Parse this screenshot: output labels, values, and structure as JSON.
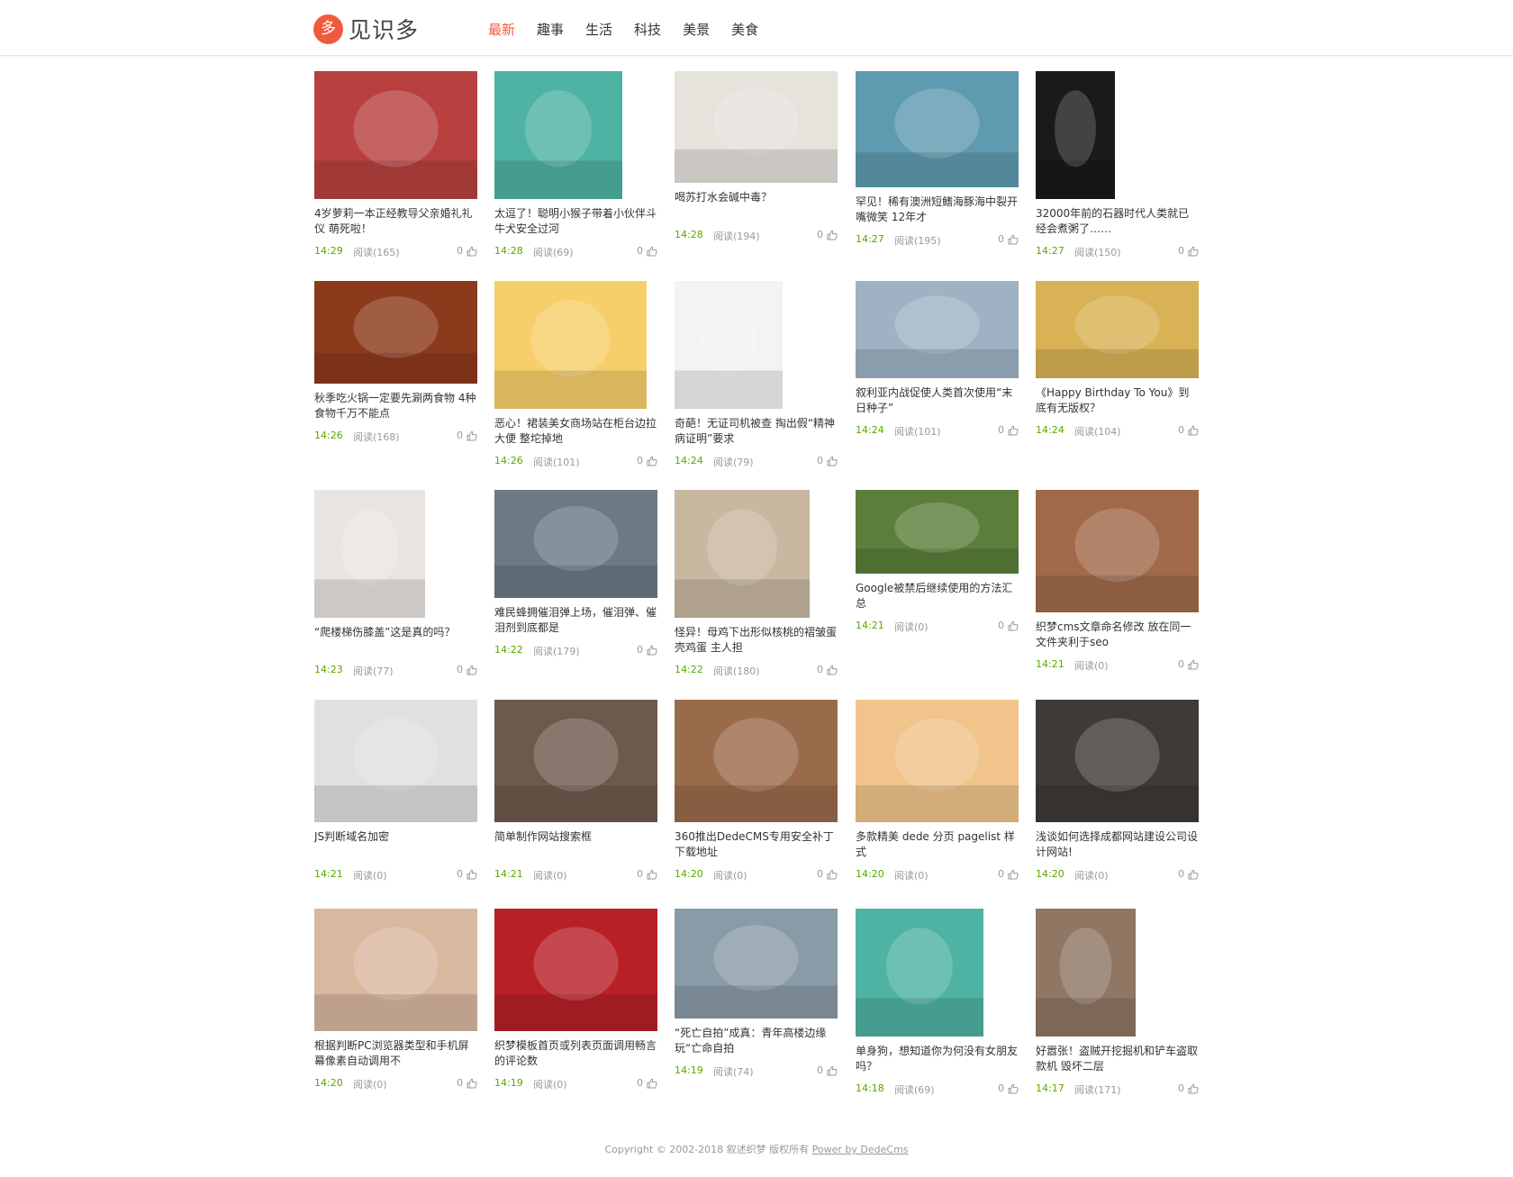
{
  "header": {
    "logo_mark": "多",
    "logo_text": "见识多",
    "nav": [
      {
        "label": "最新",
        "active": true
      },
      {
        "label": "趣事",
        "active": false
      },
      {
        "label": "生活",
        "active": false
      },
      {
        "label": "科技",
        "active": false
      },
      {
        "label": "美景",
        "active": false
      },
      {
        "label": "美食",
        "active": false
      }
    ]
  },
  "articles": [
    {
      "title": "4岁萝莉一本正经教导父亲婚礼礼仪 萌死啦！",
      "time": "14:29",
      "reads": "阅读(165)",
      "likes": "0",
      "image": "girl-red-dress-photo",
      "bg": "#b8413f"
    },
    {
      "title": "太逗了！聪明小猴子带着小伙伴斗牛犬安全过河",
      "time": "14:28",
      "reads": "阅读(69)",
      "likes": "0",
      "image": "face-mask-dog-photo",
      "bg": "#4fb3a4"
    },
    {
      "title": "喝苏打水会碱中毒？",
      "time": "14:28",
      "reads": "阅读(194)",
      "likes": "0",
      "image": "woman-drinking-water-photo",
      "bg": "#e6e2dc"
    },
    {
      "title": "罕见！稀有澳洲短鳍海豚海中裂开嘴微笑 12年才",
      "time": "14:27",
      "reads": "阅读(195)",
      "likes": "0",
      "image": "dolphin-photo",
      "bg": "#5f9bb0"
    },
    {
      "title": "32000年前的石器时代人类就已经会煮粥了……",
      "time": "14:27",
      "reads": "阅读(150)",
      "likes": "0",
      "image": "stone-tool-photo",
      "bg": "#1a1a1a"
    },
    {
      "title": "秋季吃火锅一定要先涮两食物 4种食物千万不能点",
      "time": "14:26",
      "reads": "阅读(168)",
      "likes": "0",
      "image": "hotpot-photo",
      "bg": "#8c3a1c"
    },
    {
      "title": "恶心！裙装美女商场站在柜台边拉大便 整坨掉地",
      "time": "14:26",
      "reads": "阅读(101)",
      "likes": "0",
      "image": "poop-emoji-illustration",
      "bg": "#f7cf6a"
    },
    {
      "title": "奇葩！无证司机被查 掏出假“精神病证明”要求",
      "time": "14:24",
      "reads": "阅读(79)",
      "likes": "0",
      "image": "cartoon-crazy-man-illustration",
      "bg": "#f3f3f3"
    },
    {
      "title": "叙利亚内战促使人类首次使用“末日种子”",
      "time": "14:24",
      "reads": "阅读(101)",
      "likes": "0",
      "image": "seed-vault-photo",
      "bg": "#9fb2c4"
    },
    {
      "title": "《Happy Birthday To You》到底有无版权？",
      "time": "14:24",
      "reads": "阅读(104)",
      "likes": "0",
      "image": "kids-singing-photo",
      "bg": "#d8b255"
    },
    {
      "title": "“爬楼梯伤膝盖”这是真的吗？",
      "time": "14:23",
      "reads": "阅读(77)",
      "likes": "0",
      "image": "woman-on-stairs-photo",
      "bg": "#e9e4e0"
    },
    {
      "title": "难民蜂拥催泪弹上场，催泪弹、催泪剂到底都是",
      "time": "14:22",
      "reads": "阅读(179)",
      "likes": "0",
      "image": "tear-gas-crowd-photo",
      "bg": "#6c7a86"
    },
    {
      "title": "怪异！母鸡下出形似核桃的褶皱蛋壳鸡蛋 主人担",
      "time": "14:22",
      "reads": "阅读(180)",
      "likes": "0",
      "image": "walnut-eggs-plate-photo",
      "bg": "#c8b8a0"
    },
    {
      "title": "Google被禁后继续使用的方法汇总",
      "time": "14:21",
      "reads": "阅读(0)",
      "likes": "0",
      "image": "google-sign-photo",
      "bg": "#5b7f3a"
    },
    {
      "title": "织梦cms文章命名修改 放在同一文件夹利于seo",
      "time": "14:21",
      "reads": "阅读(0)",
      "likes": "0",
      "image": "family-selfie-photo",
      "bg": "#a06a4a"
    },
    {
      "title": "JS判断域名加密",
      "time": "14:21",
      "reads": "阅读(0)",
      "likes": "0",
      "image": "waist-measure-photo",
      "bg": "#e0e0e2"
    },
    {
      "title": "简单制作网站搜索框",
      "time": "14:21",
      "reads": "阅读(0)",
      "likes": "0",
      "image": "tattooed-couple-photo",
      "bg": "#6e5a4c"
    },
    {
      "title": "360推出DedeCMS专用安全补丁下载地址",
      "time": "14:20",
      "reads": "阅读(0)",
      "likes": "0",
      "image": "old-man-baby-photo",
      "bg": "#9a6b4a"
    },
    {
      "title": "多款精美 dede 分页 pagelist 样式",
      "time": "14:20",
      "reads": "阅读(0)",
      "likes": "0",
      "image": "breakfast-photo",
      "bg": "#f0c48a"
    },
    {
      "title": "浅谈如何选择成都网站建设公司设计网站!",
      "time": "14:20",
      "reads": "阅读(0)",
      "likes": "0",
      "image": "woman-gunmen-photo",
      "bg": "#3f3a36"
    },
    {
      "title": "根据判断PC浏览器类型和手机屏幕像素自动调用不",
      "time": "14:20",
      "reads": "阅读(0)",
      "likes": "0",
      "image": "woman-portrait-photo",
      "bg": "#d9b8a0"
    },
    {
      "title": "织梦模板首页或列表页面调用畅言的评论数",
      "time": "14:19",
      "reads": "阅读(0)",
      "likes": "0",
      "image": "hands-applause-photo",
      "bg": "#b82026"
    },
    {
      "title": "“死亡自拍”成真：青年高楼边缘玩“亡命自拍",
      "time": "14:19",
      "reads": "阅读(74)",
      "likes": "0",
      "image": "bridge-selfie-photo",
      "bg": "#8a9ba8"
    },
    {
      "title": "单身狗，想知道你为何没有女朋友吗？",
      "time": "14:18",
      "reads": "阅读(69)",
      "likes": "0",
      "image": "face-mask-dog-photo",
      "bg": "#4fb3a4"
    },
    {
      "title": "好嚣张！盗贼开挖掘机和铲车盗取款机 毁坏二层",
      "time": "14:17",
      "reads": "阅读(171)",
      "likes": "0",
      "image": "collapsed-house-photo",
      "bg": "#8f7764"
    }
  ],
  "footer": {
    "text": "Copyright © 2002-2018 叙述织梦 版权所有",
    "link": "Power by DedeCms"
  }
}
